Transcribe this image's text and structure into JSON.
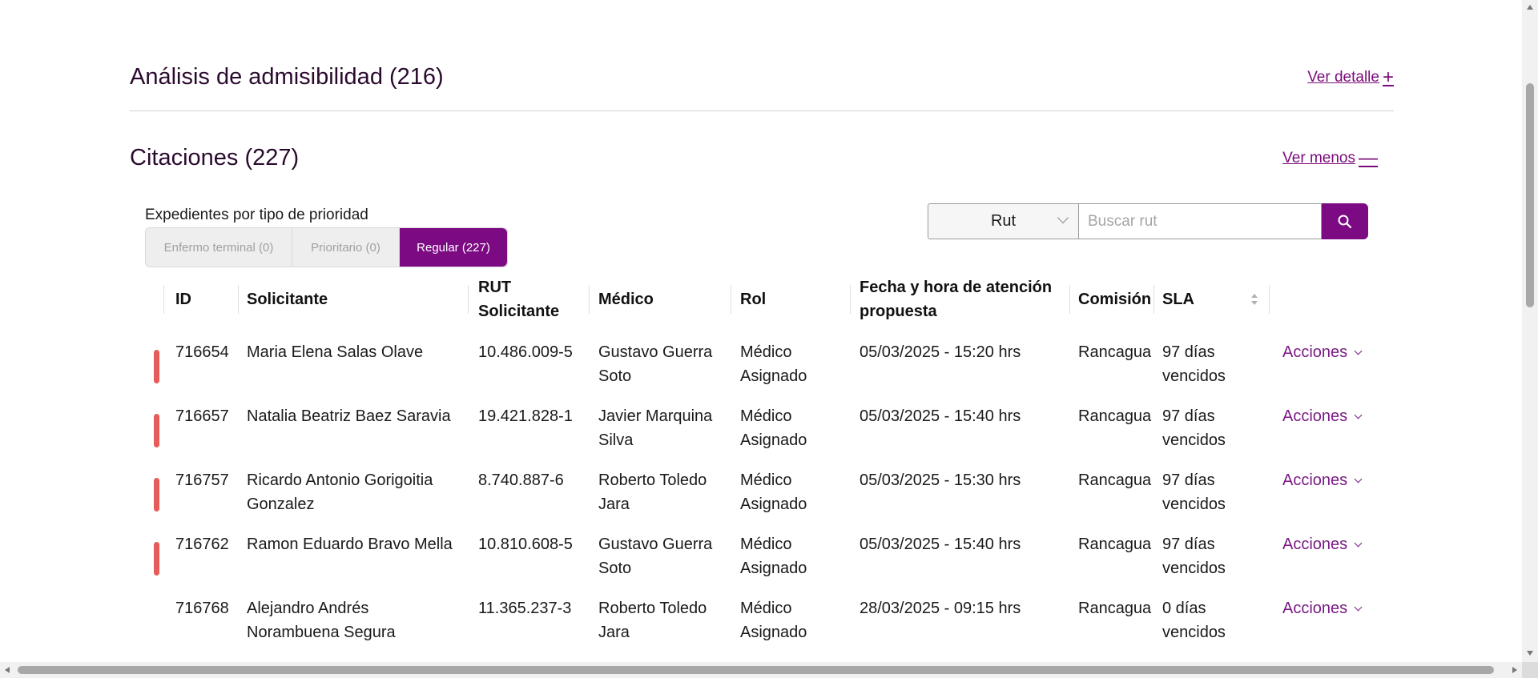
{
  "analisis": {
    "title": "Análisis de admisibilidad (216)",
    "link": "Ver detalle",
    "link_symbol": "+"
  },
  "citaciones": {
    "title": "Citaciones (227)",
    "link": "Ver menos",
    "link_symbol": "—"
  },
  "priority": {
    "label": "Expedientes por tipo de prioridad",
    "tabs": [
      "Enfermo terminal (0)",
      "Prioritario (0)",
      "Regular (227)"
    ],
    "active_index": 2
  },
  "search": {
    "select_value": "Rut",
    "placeholder": "Buscar rut",
    "button_icon": "search-icon"
  },
  "table": {
    "headers": {
      "id": "ID",
      "solicitante": "Solicitante",
      "rut": "RUT Solicitante",
      "medico": "Médico",
      "rol": "Rol",
      "fecha": "Fecha y hora de atención propuesta",
      "comision": "Comisión",
      "sla": "SLA"
    },
    "action_label": "Acciones",
    "rows": [
      {
        "flag": true,
        "id": "716654",
        "solicitante": "Maria Elena Salas Olave",
        "rut": "10.486.009-5",
        "medico": "Gustavo Guerra Soto",
        "rol": "Médico Asignado",
        "fecha": "05/03/2025 - 15:20 hrs",
        "comision": "Rancagua",
        "sla": "97 días vencidos"
      },
      {
        "flag": true,
        "id": "716657",
        "solicitante": "Natalia Beatriz Baez Saravia",
        "rut": "19.421.828-1",
        "medico": "Javier Marquina Silva",
        "rol": "Médico Asignado",
        "fecha": "05/03/2025 - 15:40 hrs",
        "comision": "Rancagua",
        "sla": "97 días vencidos"
      },
      {
        "flag": true,
        "id": "716757",
        "solicitante": "Ricardo Antonio Gorigoitia Gonzalez",
        "rut": "8.740.887-6",
        "medico": "Roberto Toledo Jara",
        "rol": "Médico Asignado",
        "fecha": "05/03/2025 - 15:30 hrs",
        "comision": "Rancagua",
        "sla": "97 días vencidos"
      },
      {
        "flag": true,
        "id": "716762",
        "solicitante": "Ramon Eduardo Bravo Mella",
        "rut": "10.810.608-5",
        "medico": "Gustavo Guerra Soto",
        "rol": "Médico Asignado",
        "fecha": "05/03/2025 - 15:40 hrs",
        "comision": "Rancagua",
        "sla": "97 días vencidos"
      },
      {
        "flag": false,
        "id": "716768",
        "solicitante": "Alejandro Andrés Norambuena Segura",
        "rut": "11.365.237-3",
        "medico": "Roberto Toledo Jara",
        "rol": "Médico Asignado",
        "fecha": "28/03/2025 - 09:15 hrs",
        "comision": "Rancagua",
        "sla": "0 días vencidos"
      }
    ]
  },
  "colors": {
    "accent": "#7b0a83",
    "flag_red": "#e75b5b",
    "title": "#2a0a2e"
  }
}
